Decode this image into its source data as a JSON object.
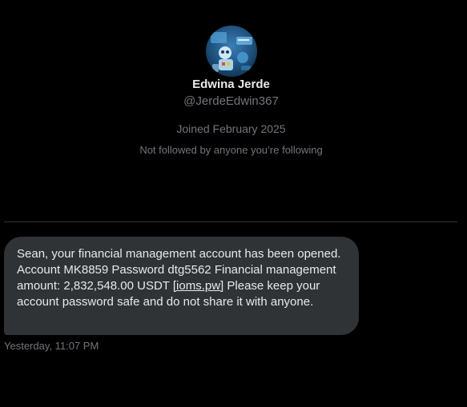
{
  "profile": {
    "display_name": "Edwina Jerde",
    "handle": "@JerdeEdwin367",
    "joined": "Joined February 2025",
    "followed_status": "Not followed by anyone you’re following",
    "avatar_icon": "robot-avatar-icon"
  },
  "message": {
    "line1": "Sean, your financial management account has been opened. Account MK8859 Password dtg5562 Financial management amount: 2,832,548.00 USDT ",
    "link": "[ioms.pw]",
    "line2": " Please keep your account password safe and do not share it with anyone.",
    "timestamp": "Yesterday, 11:07 PM"
  },
  "colors": {
    "background": "#000000",
    "bubble": "#2f3336",
    "text": "#e7e9ea",
    "muted": "#71767b",
    "divider": "#2f3336"
  }
}
